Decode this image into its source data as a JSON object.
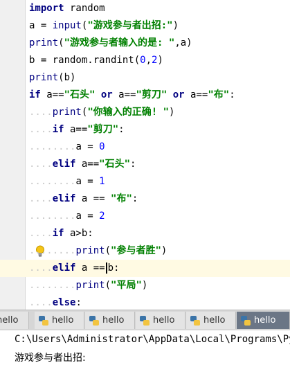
{
  "editor": {
    "lines": [
      {
        "p": [
          "import",
          " random"
        ]
      },
      {
        "p": [
          "a",
          " = ",
          "input",
          "(",
          "\"游戏参与者出招:\"",
          ")"
        ]
      },
      {
        "p": [
          "print",
          "(",
          "\"游戏参与者输入的是: \"",
          ",a)"
        ]
      },
      {
        "p": [
          "b = random.randint(",
          "0",
          ",",
          "2",
          ")"
        ]
      },
      {
        "p": [
          "print",
          "(b)"
        ]
      },
      {
        "p": [
          "if",
          " a==",
          "\"石头\"",
          " ",
          "or",
          " a==",
          "\"剪刀\"",
          " ",
          "or",
          " a==",
          "\"布\"",
          ":"
        ]
      },
      {
        "p": [
          "....",
          "print",
          "(",
          "\"你输入的正确! \"",
          ")"
        ]
      },
      {
        "p": [
          "....",
          "if",
          " a==",
          "\"剪刀\"",
          ":"
        ]
      },
      {
        "p": [
          "........",
          "a = ",
          "0"
        ]
      },
      {
        "p": [
          "....",
          "elif",
          " a==",
          "\"石头\"",
          ":"
        ]
      },
      {
        "p": [
          "........",
          "a = ",
          "1"
        ]
      },
      {
        "p": [
          "....",
          "elif",
          " a == ",
          "\"布\"",
          ":"
        ]
      },
      {
        "p": [
          "........",
          "a = ",
          "2"
        ]
      },
      {
        "p": [
          "....",
          "if",
          " a>b:"
        ]
      },
      {
        "p": [
          "....",
          "....",
          "print",
          "(",
          "\"参与者胜\"",
          ")"
        ]
      },
      {
        "p": [
          "....",
          "elif",
          " a ==",
          "b:"
        ]
      },
      {
        "p": [
          "........",
          "print",
          "(",
          "\"平局\"",
          ")"
        ]
      },
      {
        "p": [
          "....",
          "else",
          ":"
        ]
      }
    ]
  },
  "tabs": [
    {
      "label": "hello"
    },
    {
      "label": "hello"
    },
    {
      "label": "hello"
    },
    {
      "label": "hello"
    },
    {
      "label": "hello"
    },
    {
      "label": "hello"
    }
  ],
  "console": {
    "path": "C:\\Users\\Administrator\\AppData\\Local\\Programs\\Pyth",
    "prompt": "游戏参与者出招:"
  }
}
